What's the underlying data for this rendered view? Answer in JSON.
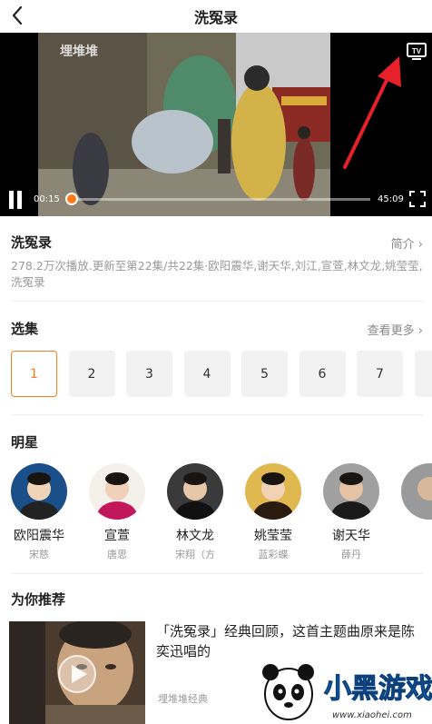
{
  "header": {
    "title": "洗冤录"
  },
  "player": {
    "watermark": "埋堆堆",
    "current_time": "00:15",
    "total_time": "45:09",
    "progress": 0.01,
    "tv_label": "TV"
  },
  "info": {
    "title": "洗冤录",
    "intro_link": "简介",
    "description": "278.2万次播放.更新至第22集/共22集·欧阳震华,谢天华,刘江,宣萱,林文龙,姚莹莹,洗冤录"
  },
  "episodes": {
    "title": "选集",
    "more_link": "查看更多",
    "items": [
      "1",
      "2",
      "3",
      "4",
      "5",
      "6",
      "7"
    ],
    "selected": "1"
  },
  "stars": {
    "title": "明星",
    "items": [
      {
        "name": "欧阳震华",
        "role": "宋慈"
      },
      {
        "name": "宣萱",
        "role": "唐思"
      },
      {
        "name": "林文龙",
        "role": "宋翔（方"
      },
      {
        "name": "姚莹莹",
        "role": "蓝彩蝶"
      },
      {
        "name": "谢天华",
        "role": "薛丹"
      }
    ]
  },
  "recommend": {
    "title": "为你推荐",
    "items": [
      {
        "title": "「洗冤录」经典回顾，这首主题曲原来是陈奕迅唱的",
        "source": "埋堆堆经典"
      }
    ]
  },
  "logo": {
    "text": "小黑游戏",
    "url_text": "www.xiaohei.com"
  },
  "colors": {
    "accent": "#ff7a1a",
    "annotation_arrow": "#e8202a"
  }
}
